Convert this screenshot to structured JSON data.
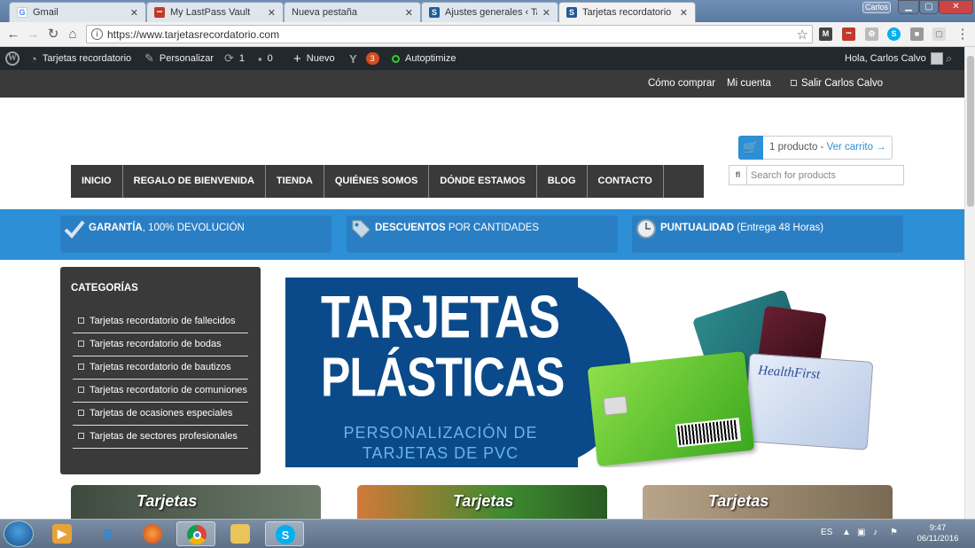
{
  "browser": {
    "tabs": [
      {
        "label": "Gmail",
        "favicon": "G",
        "favicon_color": "#ffffff",
        "favicon_text": "#4285f4"
      },
      {
        "label": "My LastPass Vault",
        "favicon": "•••",
        "favicon_color": "#c0392b",
        "favicon_text": "#ffffff"
      },
      {
        "label": "Nueva pestaña",
        "favicon": "",
        "favicon_color": "transparent",
        "favicon_text": "#333"
      },
      {
        "label": "Ajustes generales ‹ Tarje",
        "favicon": "S",
        "favicon_color": "#1e5c9a",
        "favicon_text": "#ffffff"
      },
      {
        "label": "Tarjetas recordatorio - Pl",
        "favicon": "S",
        "favicon_color": "#1e5c9a",
        "favicon_text": "#ffffff"
      }
    ],
    "window_user": "Carlos",
    "url": "https://www.tarjetasrecordatorio.com",
    "extensions": [
      "M",
      "•••",
      "⚙",
      "S",
      "■",
      "▢"
    ]
  },
  "adminbar": {
    "site_name": "Tarjetas recordatorio",
    "customize": "Personalizar",
    "updates_count": "1",
    "comments_count": "0",
    "new_label": "Nuevo",
    "yoast_count": "3",
    "autoptimize": "Autoptimize",
    "greeting": "Hola, Carlos Calvo"
  },
  "account_bar": {
    "how_to_buy": "Cómo comprar",
    "my_account": "Mi cuenta",
    "logout": "Salir Carlos Calvo"
  },
  "cart": {
    "count_text": "1 producto - ",
    "link_text": "Ver carrito →"
  },
  "nav": {
    "items": [
      "INICIO",
      "REGALO DE BIENVENIDA",
      "TIENDA",
      "QUIÉNES SOMOS",
      "DÓNDE ESTAMOS",
      "BLOG",
      "CONTACTO"
    ]
  },
  "search": {
    "icon": "fl",
    "placeholder": "Search for products"
  },
  "benefits": [
    {
      "bold": "GARANTÍA",
      "rest": ", 100% DEVOLUCIÓN",
      "icon": "check-icon"
    },
    {
      "bold": "DESCUENTOS",
      "rest": " POR CANTIDADES",
      "icon": "tag-icon"
    },
    {
      "bold": "PUNTUALIDAD",
      "rest": " (Entrega 48 Horas)",
      "icon": "clock-icon"
    }
  ],
  "sidebar": {
    "title": "CATEGORÍAS",
    "items": [
      "Tarjetas recordatorio de fallecidos",
      "Tarjetas recordatorio de bodas",
      "Tarjetas recordatorio de bautizos",
      "Tarjetas recordatorio de comuniones",
      "Tarjetas de ocasiones especiales",
      "Tarjetas de sectores profesionales"
    ]
  },
  "banner": {
    "title_line1": "TARJETAS",
    "title_line2": "PLÁSTICAS",
    "subtitle_line1": "PERSONALIZACIÓN DE",
    "subtitle_line2": "TARJETAS DE PVC",
    "card_brand": "HealthFirst"
  },
  "category_cards": [
    {
      "title": "Tarjetas"
    },
    {
      "title": "Tarjetas"
    },
    {
      "title": "Tarjetas"
    }
  ],
  "taskbar": {
    "lang": "ES",
    "time": "9:47",
    "date": "06/11/2016"
  },
  "colors": {
    "accent_blue": "#2d8fd5",
    "dark_bar": "#3a3a3a",
    "wp_admin": "#23282d"
  }
}
